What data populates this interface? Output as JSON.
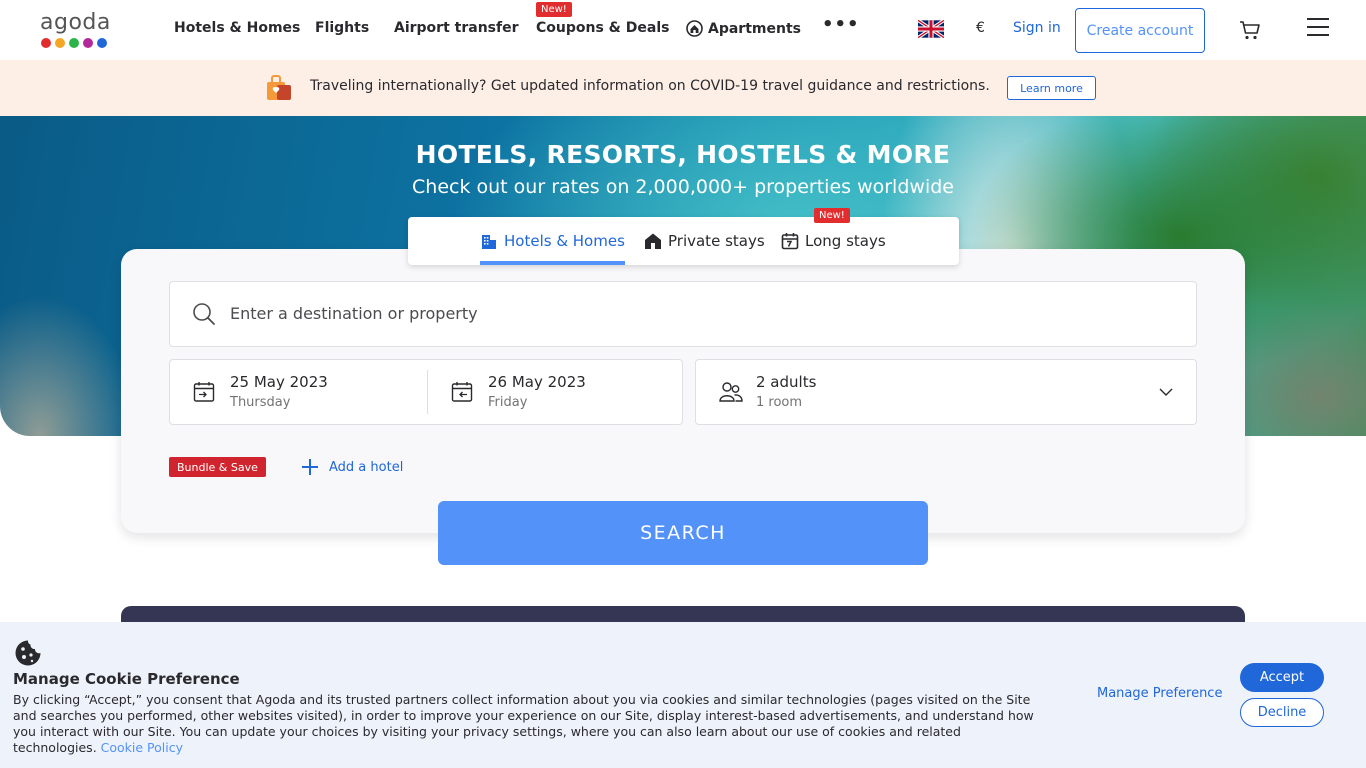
{
  "nav": {
    "logo_text": "agoda",
    "logo_colors": [
      "#e12d2d",
      "#f5a623",
      "#2cb34a",
      "#b3299b",
      "#2067da"
    ],
    "links": {
      "hotels": "Hotels & Homes",
      "flights": "Flights",
      "airport": "Airport transfer",
      "coupons": "Coupons & Deals",
      "apartments": "Apartments"
    },
    "coupons_badge": "New!",
    "more_icon": "ellipsis-icon",
    "currency": "€",
    "sign_in": "Sign in",
    "create_account": "Create account"
  },
  "covid_banner": {
    "text": "Traveling internationally? Get updated information on COVID-19 travel guidance and restrictions.",
    "learn_more": "Learn more"
  },
  "hero": {
    "title": "HOTELS, RESORTS, HOSTELS & MORE",
    "subtitle": "Check out our rates on 2,000,000+ properties worldwide"
  },
  "search": {
    "tabs": [
      {
        "label": "Hotels & Homes",
        "active": true
      },
      {
        "label": "Private stays",
        "active": false
      },
      {
        "label": "Long stays",
        "active": false
      }
    ],
    "long_stays_badge": "New!",
    "destination_placeholder": "Enter a destination or property",
    "check_in": {
      "date": "25 May 2023",
      "day": "Thursday"
    },
    "check_out": {
      "date": "26 May 2023",
      "day": "Friday"
    },
    "guests": {
      "main": "2 adults",
      "sub": "1 room"
    },
    "bundle_label": "Bundle & Save",
    "add_hotel": "Add a hotel",
    "search_button": "SEARCH"
  },
  "cookie": {
    "title": "Manage Cookie Preference",
    "body": "By clicking “Accept,” you consent that Agoda and its trusted partners collect information about you via cookies and similar technologies (pages visited on the Site and searches you performed, other websites visited), in order to improve your experience on our Site, display interest-based advertisements, and understand how you interact with our Site. You can update your choices by visiting your privacy settings, where you can also learn about our use of cookies and related technologies.",
    "policy_link": "Cookie Policy",
    "manage_preference": "Manage Preference",
    "accept": "Accept",
    "decline": "Decline"
  },
  "colors": {
    "brand_blue": "#5392f9",
    "link_blue": "#2067da",
    "badge_red": "#e12d2d",
    "covid_bg": "#fdeee6",
    "cookie_bg": "#eef2fa"
  }
}
